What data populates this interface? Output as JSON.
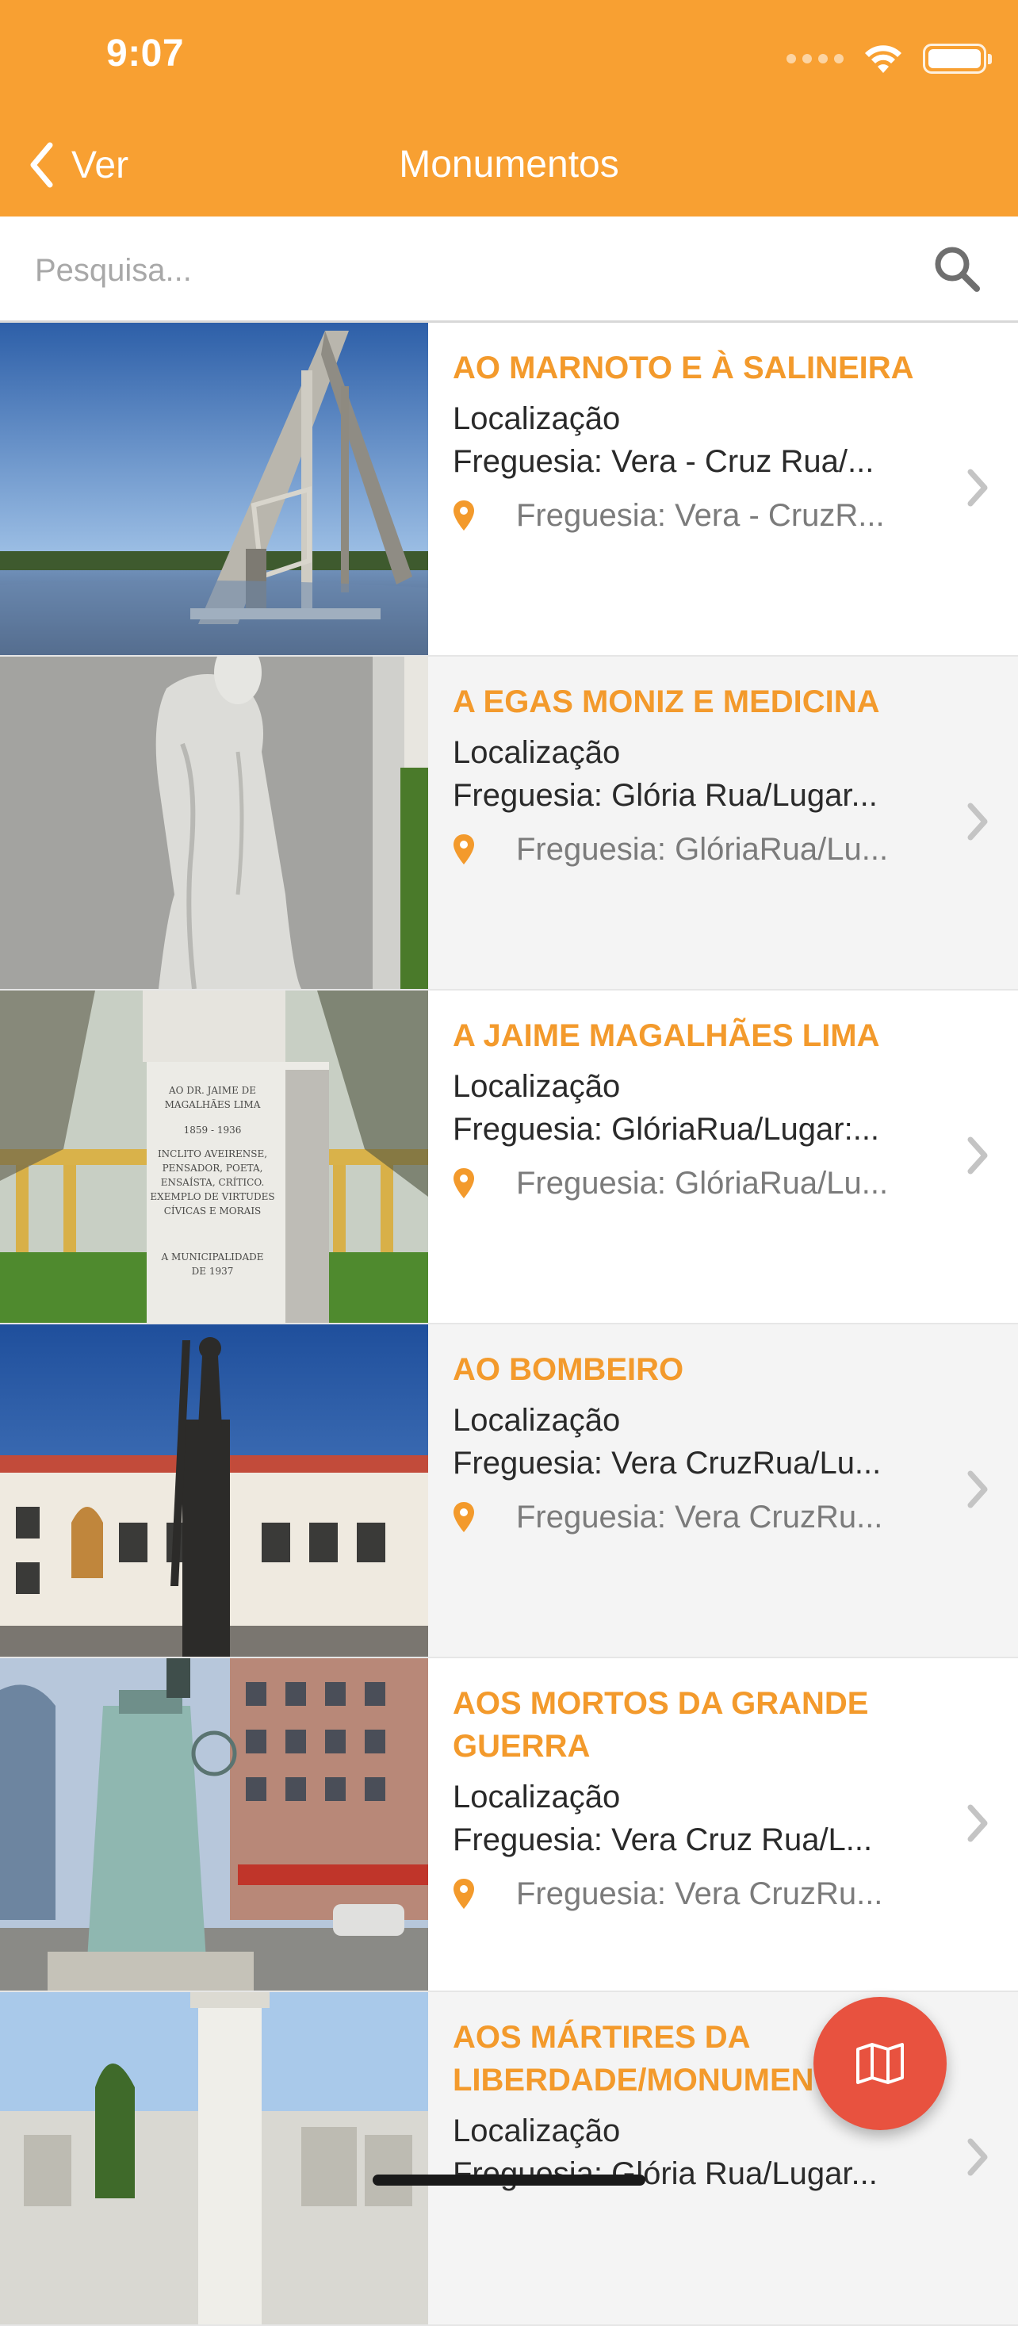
{
  "status_bar": {
    "time": "9:07"
  },
  "nav": {
    "back_label": "Ver",
    "title": "Monumentos"
  },
  "search": {
    "placeholder": "Pesquisa...",
    "value": ""
  },
  "colors": {
    "brand": "#F8A032",
    "title_text": "#F39A2C",
    "fab": "#E8523F"
  },
  "items": [
    {
      "title": " AO MARNOTO E À SALINEIRA",
      "loc_label": "Localização",
      "loc_line": "Freguesia: Vera - Cruz Rua/...",
      "address": "Freguesia: Vera - CruzR..."
    },
    {
      "title": "A EGAS MONIZ E MEDICINA",
      "loc_label": "Localização",
      "loc_line": "Freguesia: Glória Rua/Lugar...",
      "address": "Freguesia: GlóriaRua/Lu..."
    },
    {
      "title": "A JAIME MAGALHÃES LIMA",
      "loc_label": "Localização",
      "loc_line": "Freguesia: GlóriaRua/Lugar:...",
      "address": "Freguesia: GlóriaRua/Lu...",
      "plaque": [
        "AO DR. JAIME DE",
        "MAGALHÃES LIMA",
        "1859 - 1936",
        "INCLITO AVEIRENSE,",
        "PENSADOR, POETA,",
        "ENSAÍSTA, CRÍTICO.",
        "EXEMPLO DE VIRTUDES",
        "CÍVICAS E MORAIS",
        "A MUNICIPALIDADE",
        "DE 1937"
      ]
    },
    {
      "title": "AO BOMBEIRO",
      "loc_label": "Localização",
      "loc_line": "Freguesia: Vera CruzRua/Lu...",
      "address": "Freguesia: Vera CruzRu..."
    },
    {
      "title": "AOS MORTOS DA GRANDE GUERRA",
      "loc_label": "Localização",
      "loc_line": "Freguesia: Vera Cruz Rua/L...",
      "address": "Freguesia: Vera CruzRu..."
    },
    {
      "title": "AOS MÁRTIRES DA LIBERDADE/MONUMENTO",
      "loc_label": "Localização",
      "loc_line": "Freguesia: Glória Rua/Lugar...",
      "address": ""
    }
  ],
  "icons": {
    "back": "chevron-left-icon",
    "search": "magnifier-icon",
    "pin": "map-pin-icon",
    "disclosure": "chevron-right-icon",
    "fab": "map-icon"
  }
}
